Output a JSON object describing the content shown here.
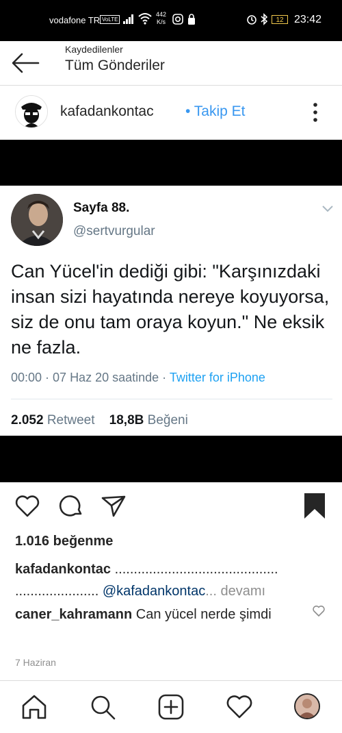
{
  "status_bar": {
    "carrier": "vodafone TR",
    "volte": "VoLTE",
    "speed_value": "442",
    "speed_unit": "K/s",
    "battery": "12",
    "time": "23:42"
  },
  "header": {
    "subtitle": "Kaydedilenler",
    "title": "Tüm Gönderiler"
  },
  "post": {
    "author": "kafadankontac",
    "follow_label": "• Takip Et",
    "tweet": {
      "name": "Sayfa 88.",
      "handle": "@sertvurgular",
      "text": "Can Yücel'in dediği gibi: \"Karşınızdaki insan sizi hayatında nereye koyuyorsa, siz de onu tam oraya koyun.\" Ne eksik ne fazla.",
      "meta_time": "00:00 · 07 Haz 20 saatinde · ",
      "meta_source": "Twitter for iPhone",
      "retweet_count": "2.052",
      "retweet_label": "Retweet",
      "like_count": "18,8B",
      "like_label": "Beğeni"
    },
    "likes_text": "1.016 beğenme",
    "caption": {
      "username": "kafadankontac",
      "dots1": " ...........................................",
      "dots2": "...................... ",
      "mention": "@kafadankontac",
      "more": "... devamı"
    },
    "comment": {
      "username": "caner_kahramann",
      "text": " Can yücel nerde şimdi"
    },
    "date": "7 Haziran"
  },
  "icons": {
    "back": "arrow-left-icon",
    "more": "more-vertical-icon",
    "like": "heart-icon",
    "comment": "comment-icon",
    "share": "send-icon",
    "save": "bookmark-icon",
    "home": "home-icon",
    "search": "search-icon",
    "add": "add-icon",
    "activity": "heart-icon"
  },
  "colors": {
    "link": "#3897f0",
    "twitter_blue": "#1da1f2",
    "muted": "#8e8e8e"
  }
}
